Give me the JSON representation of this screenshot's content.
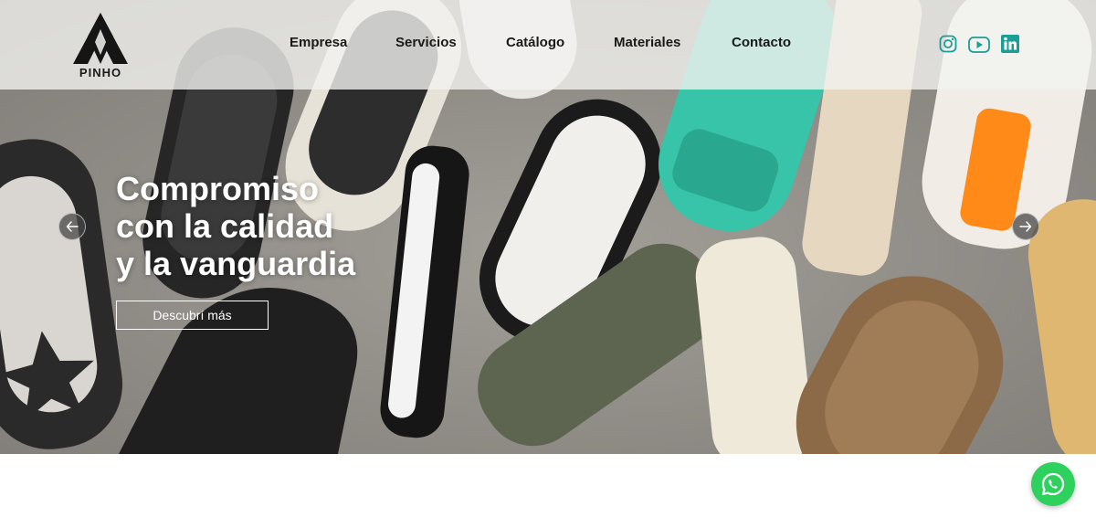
{
  "brand": {
    "logo_text": "PINHO"
  },
  "nav": {
    "items": [
      {
        "label": "Empresa"
      },
      {
        "label": "Servicios"
      },
      {
        "label": "Catálogo"
      },
      {
        "label": "Materiales"
      },
      {
        "label": "Contacto"
      }
    ]
  },
  "social": {
    "icons": [
      "instagram-icon",
      "youtube-icon",
      "linkedin-icon"
    ],
    "color": "#1a9e96"
  },
  "hero": {
    "headline": [
      "Compromiso",
      "con la calidad",
      "y la vanguardia"
    ],
    "cta_label": "Descubrí más",
    "prev_icon": "arrow-left-icon",
    "next_icon": "arrow-right-icon"
  },
  "floating": {
    "whatsapp_icon": "whatsapp-icon",
    "whatsapp_color": "#2fd15e"
  }
}
